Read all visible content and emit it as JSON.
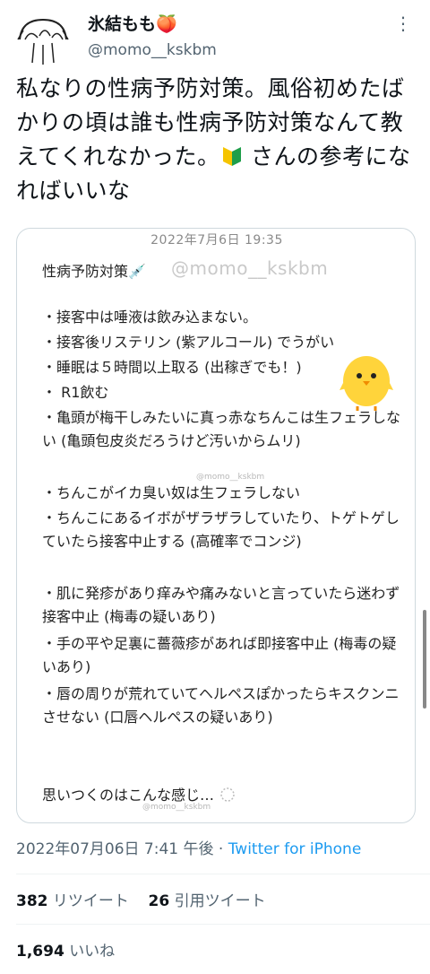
{
  "user": {
    "display_name": "氷結もも🍑",
    "handle": "@momo__kskbm"
  },
  "tweet": {
    "text_before_badge": "私なりの性病予防対策。風俗初めたばかりの頃は誰も性病予防対策なんて教えてくれなかった。",
    "text_after_badge": "さんの参考になればいいな"
  },
  "card": {
    "date": "2022年7月6日 19:35",
    "title": "性病予防対策💉",
    "watermark": "@momo__kskbm",
    "items": [
      "・接客中は唾液は飲み込まない。",
      "・接客後リステリン (紫アルコール) でうがい",
      "・睡眠は５時間以上取る (出稼ぎでも！)",
      "・ R1飲む",
      "・亀頭が梅干しみたいに真っ赤なちんこは生フェラしない (亀頭包皮炎だろうけど汚いからムリ)",
      "・ちんこがイカ臭い奴は生フェラしない",
      "・ちんこにあるイボがザラザラしていたり、トゲトゲしていたら接客中止する (高確率でコンジ)",
      "・肌に発疹があり痒みや痛みないと言っていたら迷わず接客中止 (梅毒の疑いあり)",
      "・手の平や足裏に薔薇疹があれば即接客中止 (梅毒の疑いあり)",
      "・唇の周りが荒れていてヘルペスぽかったらキスクンニさせない (口唇ヘルペスの疑いあり)"
    ],
    "closing": "思いつくのはこんな感じ…"
  },
  "meta": {
    "timestamp": "2022年07月06日 7:41 午後 · ",
    "source": "Twitter for iPhone"
  },
  "stats": {
    "retweets_count": "382",
    "retweets_label": "リツイート",
    "quotes_count": "26",
    "quotes_label": "引用ツイート",
    "likes_count": "1,694",
    "likes_label": "いいね"
  },
  "colors": {
    "link": "#1d9bf0",
    "secondary": "#536471",
    "border": "#cfd9de"
  }
}
